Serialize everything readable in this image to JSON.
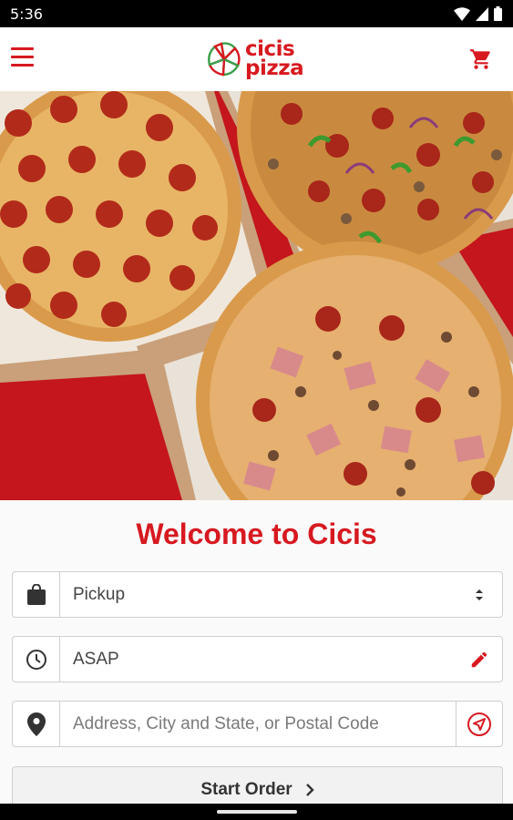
{
  "status_bar": {
    "time": "5:36"
  },
  "header": {
    "logo_line1": "cicis",
    "logo_line2": "pizza",
    "brand_color": "#d71920"
  },
  "welcome": {
    "title": "Welcome to Cicis"
  },
  "order_form": {
    "order_type": {
      "icon": "shopping-bag-icon",
      "value": "Pickup",
      "trailing_icon": "select-arrows-icon"
    },
    "time": {
      "icon": "clock-icon",
      "value": "ASAP",
      "trailing_icon": "edit-pencil-icon"
    },
    "address": {
      "icon": "location-pin-icon",
      "placeholder": "Address, City and State, or Postal Code",
      "value": "",
      "trailing_icon": "locate-me-icon"
    }
  },
  "start_order": {
    "label": "Start Order",
    "icon": "chevron-right-icon"
  }
}
